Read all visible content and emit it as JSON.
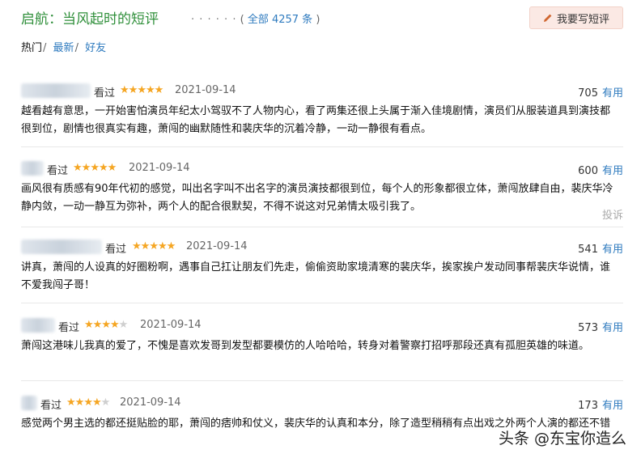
{
  "header": {
    "title": "启航：当风起时的短评",
    "dots": "· · · · · ·",
    "count_prefix": "( ",
    "count_link": "全部 4257 条",
    "count_suffix": " )",
    "write_button": "我要写短评"
  },
  "tabs": {
    "hot": "热门",
    "sep": "/",
    "latest": "最新",
    "friends": "好友"
  },
  "comments": [
    {
      "status": "看过",
      "rating": 5,
      "date": "2021-09-14",
      "votes": "705",
      "useful_label": "有用",
      "text": "越看越有意思，一开始害怕演员年纪太小驾驭不了人物内心，看了两集还很上头属于渐入佳境剧情，演员们从服装道具到演技都很到位，剧情也很真实有趣，萧闯的幽默随性和裴庆华的沉着冷静，一动一静很有看点。"
    },
    {
      "status": "看过",
      "rating": 5,
      "date": "2021-09-14",
      "votes": "600",
      "useful_label": "有用",
      "text": "画风很有质感有90年代初的感觉，叫出名字叫不出名字的演员演技都很到位，每个人的形象都很立体，萧闯放肆自由，裴庆华冷静内敛，一动一静互为弥补，两个人的配合很默契，不得不说这对兄弟情太吸引我了。",
      "report": "投诉"
    },
    {
      "status": "看过",
      "rating": 5,
      "date": "2021-09-14",
      "votes": "541",
      "useful_label": "有用",
      "text": "讲真，萧闯的人设真的好圈粉啊，遇事自己扛让朋友们先走，偷偷资助家境清寒的裴庆华，挨家挨户发动同事帮裴庆华说情，谁不爱我闯子哥！"
    },
    {
      "status": "看过",
      "rating": 4,
      "date": "2021-09-14",
      "votes": "573",
      "useful_label": "有用",
      "text": "萧闯这港味儿我真的爱了，不愧是喜欢发哥到发型都要模仿的人哈哈哈，转身对着警察打招呼那段还真有孤胆英雄的味道。"
    },
    {
      "status": "看过",
      "rating": 4,
      "date": "2021-09-14",
      "votes": "173",
      "useful_label": "有用",
      "text": "感觉两个男主选的都还挺贴脸的耶，萧闯的痞帅和仗义，裴庆华的认真和本分，除了造型稍稍有点出戏之外两个人演的都还不错"
    }
  ],
  "watermark": "头条 @东宝你造么",
  "colors": {
    "title_green": "#2f8f3a",
    "link_blue": "#2f7bbf",
    "star_gold": "#f5a623",
    "button_bg": "#fbe9e4"
  },
  "icons": {
    "write": "pencil-icon",
    "star": "star-icon"
  }
}
